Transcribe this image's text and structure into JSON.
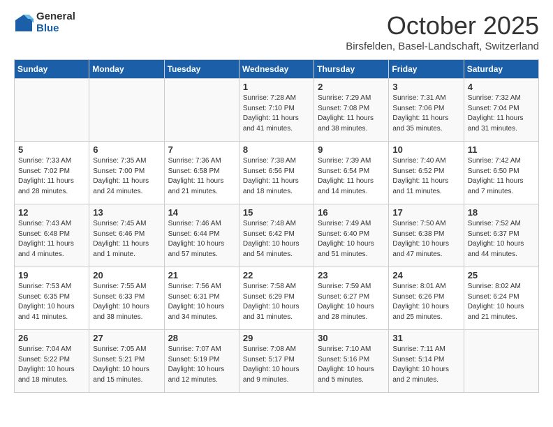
{
  "header": {
    "logo_general": "General",
    "logo_blue": "Blue",
    "month_title": "October 2025",
    "location": "Birsfelden, Basel-Landschaft, Switzerland"
  },
  "weekdays": [
    "Sunday",
    "Monday",
    "Tuesday",
    "Wednesday",
    "Thursday",
    "Friday",
    "Saturday"
  ],
  "weeks": [
    [
      {
        "day": "",
        "info": ""
      },
      {
        "day": "",
        "info": ""
      },
      {
        "day": "",
        "info": ""
      },
      {
        "day": "1",
        "info": "Sunrise: 7:28 AM\nSunset: 7:10 PM\nDaylight: 11 hours and 41 minutes."
      },
      {
        "day": "2",
        "info": "Sunrise: 7:29 AM\nSunset: 7:08 PM\nDaylight: 11 hours and 38 minutes."
      },
      {
        "day": "3",
        "info": "Sunrise: 7:31 AM\nSunset: 7:06 PM\nDaylight: 11 hours and 35 minutes."
      },
      {
        "day": "4",
        "info": "Sunrise: 7:32 AM\nSunset: 7:04 PM\nDaylight: 11 hours and 31 minutes."
      }
    ],
    [
      {
        "day": "5",
        "info": "Sunrise: 7:33 AM\nSunset: 7:02 PM\nDaylight: 11 hours and 28 minutes."
      },
      {
        "day": "6",
        "info": "Sunrise: 7:35 AM\nSunset: 7:00 PM\nDaylight: 11 hours and 24 minutes."
      },
      {
        "day": "7",
        "info": "Sunrise: 7:36 AM\nSunset: 6:58 PM\nDaylight: 11 hours and 21 minutes."
      },
      {
        "day": "8",
        "info": "Sunrise: 7:38 AM\nSunset: 6:56 PM\nDaylight: 11 hours and 18 minutes."
      },
      {
        "day": "9",
        "info": "Sunrise: 7:39 AM\nSunset: 6:54 PM\nDaylight: 11 hours and 14 minutes."
      },
      {
        "day": "10",
        "info": "Sunrise: 7:40 AM\nSunset: 6:52 PM\nDaylight: 11 hours and 11 minutes."
      },
      {
        "day": "11",
        "info": "Sunrise: 7:42 AM\nSunset: 6:50 PM\nDaylight: 11 hours and 7 minutes."
      }
    ],
    [
      {
        "day": "12",
        "info": "Sunrise: 7:43 AM\nSunset: 6:48 PM\nDaylight: 11 hours and 4 minutes."
      },
      {
        "day": "13",
        "info": "Sunrise: 7:45 AM\nSunset: 6:46 PM\nDaylight: 11 hours and 1 minute."
      },
      {
        "day": "14",
        "info": "Sunrise: 7:46 AM\nSunset: 6:44 PM\nDaylight: 10 hours and 57 minutes."
      },
      {
        "day": "15",
        "info": "Sunrise: 7:48 AM\nSunset: 6:42 PM\nDaylight: 10 hours and 54 minutes."
      },
      {
        "day": "16",
        "info": "Sunrise: 7:49 AM\nSunset: 6:40 PM\nDaylight: 10 hours and 51 minutes."
      },
      {
        "day": "17",
        "info": "Sunrise: 7:50 AM\nSunset: 6:38 PM\nDaylight: 10 hours and 47 minutes."
      },
      {
        "day": "18",
        "info": "Sunrise: 7:52 AM\nSunset: 6:37 PM\nDaylight: 10 hours and 44 minutes."
      }
    ],
    [
      {
        "day": "19",
        "info": "Sunrise: 7:53 AM\nSunset: 6:35 PM\nDaylight: 10 hours and 41 minutes."
      },
      {
        "day": "20",
        "info": "Sunrise: 7:55 AM\nSunset: 6:33 PM\nDaylight: 10 hours and 38 minutes."
      },
      {
        "day": "21",
        "info": "Sunrise: 7:56 AM\nSunset: 6:31 PM\nDaylight: 10 hours and 34 minutes."
      },
      {
        "day": "22",
        "info": "Sunrise: 7:58 AM\nSunset: 6:29 PM\nDaylight: 10 hours and 31 minutes."
      },
      {
        "day": "23",
        "info": "Sunrise: 7:59 AM\nSunset: 6:27 PM\nDaylight: 10 hours and 28 minutes."
      },
      {
        "day": "24",
        "info": "Sunrise: 8:01 AM\nSunset: 6:26 PM\nDaylight: 10 hours and 25 minutes."
      },
      {
        "day": "25",
        "info": "Sunrise: 8:02 AM\nSunset: 6:24 PM\nDaylight: 10 hours and 21 minutes."
      }
    ],
    [
      {
        "day": "26",
        "info": "Sunrise: 7:04 AM\nSunset: 5:22 PM\nDaylight: 10 hours and 18 minutes."
      },
      {
        "day": "27",
        "info": "Sunrise: 7:05 AM\nSunset: 5:21 PM\nDaylight: 10 hours and 15 minutes."
      },
      {
        "day": "28",
        "info": "Sunrise: 7:07 AM\nSunset: 5:19 PM\nDaylight: 10 hours and 12 minutes."
      },
      {
        "day": "29",
        "info": "Sunrise: 7:08 AM\nSunset: 5:17 PM\nDaylight: 10 hours and 9 minutes."
      },
      {
        "day": "30",
        "info": "Sunrise: 7:10 AM\nSunset: 5:16 PM\nDaylight: 10 hours and 5 minutes."
      },
      {
        "day": "31",
        "info": "Sunrise: 7:11 AM\nSunset: 5:14 PM\nDaylight: 10 hours and 2 minutes."
      },
      {
        "day": "",
        "info": ""
      }
    ]
  ]
}
